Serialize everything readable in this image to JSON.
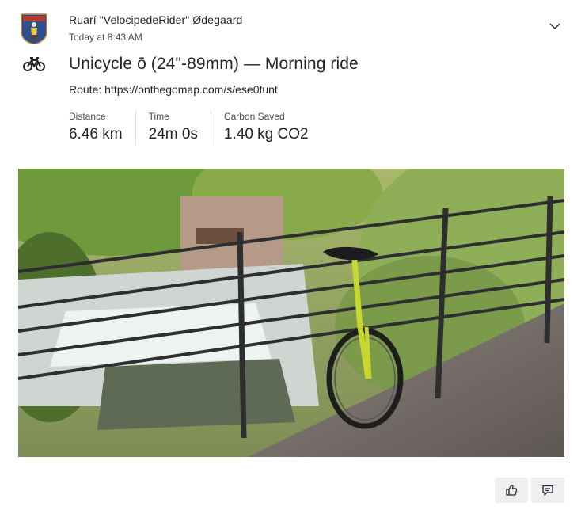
{
  "athlete": {
    "name": "Ruarí \"VelocipedeRider\" Ødegaard",
    "timestamp": "Today at 8:43 AM",
    "avatar_icon": "heraldic-shield-avatar"
  },
  "activity": {
    "sport_icon": "bicycle-icon",
    "title": "Unicycle ō (24\"-89mm) — Morning ride",
    "route": "Route: https://onthegomap.com/s/ese0funt"
  },
  "stats": [
    {
      "label": "Distance",
      "value": "6.46 km"
    },
    {
      "label": "Time",
      "value": "24m 0s"
    },
    {
      "label": "Carbon Saved",
      "value": "1.40 kg CO2"
    }
  ],
  "actions": {
    "menu_icon": "chevron-down-icon",
    "kudos_icon": "thumbs-up-icon",
    "comment_icon": "comment-icon"
  },
  "colors": {
    "text": "#242428",
    "muted": "#494950",
    "button_bg": "#efeff2",
    "unicycle_frame": "#c8d630"
  }
}
